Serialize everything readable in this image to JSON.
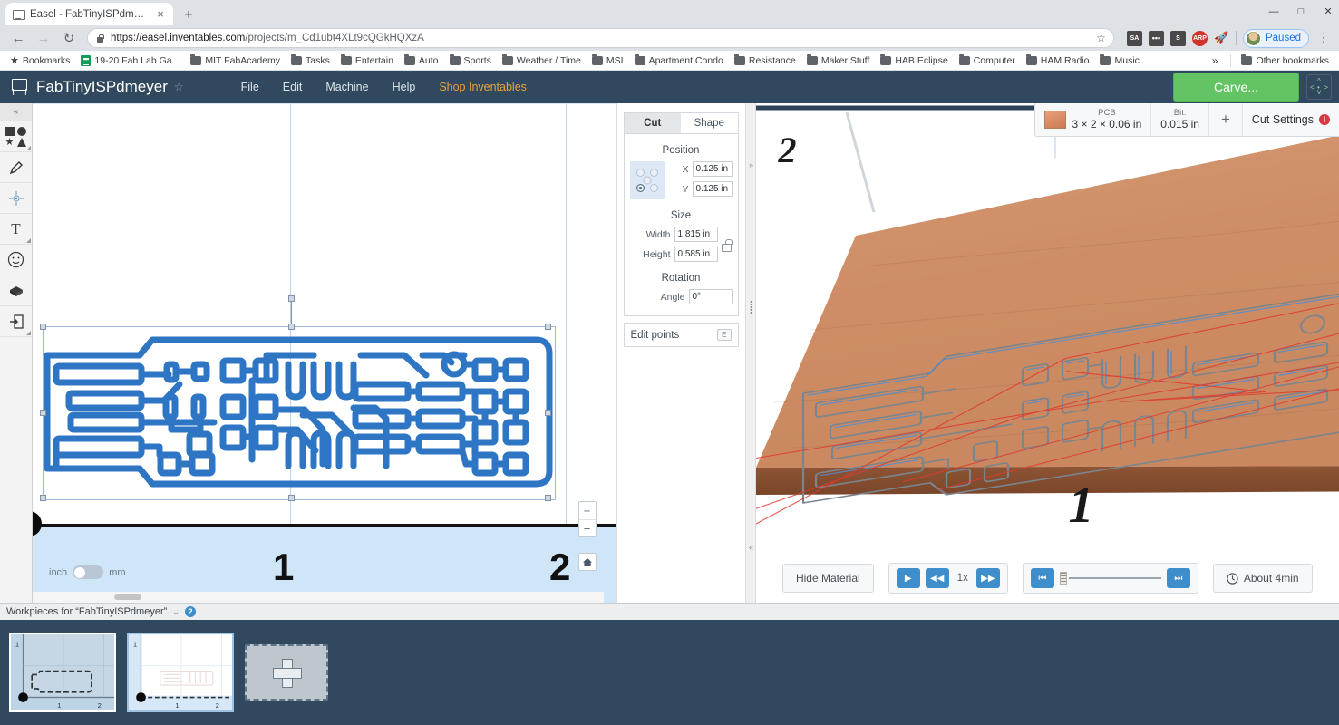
{
  "browser": {
    "tab": {
      "title": "Easel - FabTinyISPdmeyer",
      "favicon": "easel-icon",
      "close": "×"
    },
    "new_tab": "+",
    "window_controls": [
      "—",
      "□",
      "✕"
    ],
    "nav": {
      "back": "←",
      "forward": "→",
      "reload": "↻"
    },
    "url": {
      "scheme_host": "https://easel.inventables.com",
      "path": "/projects/m_Cd1ubt4XLt9cQGkHQXzA",
      "lock": "lock-icon",
      "star": "☆"
    },
    "extensions": [
      {
        "name": "sa-extension",
        "label": "SA",
        "color": "#4a4a4a"
      },
      {
        "name": "dots-extension",
        "label": "•••",
        "color": "#4a4a4a"
      },
      {
        "name": "s-extension",
        "label": "S",
        "color": "#4a4a4a"
      },
      {
        "name": "arp-extension",
        "label": "ARP",
        "color": "#d0342c"
      },
      {
        "name": "rocket-extension",
        "label": "🚀",
        "color": "#e8a33d"
      }
    ],
    "profile": {
      "label": "Paused"
    },
    "kebab": "⋮",
    "bookmarks": [
      {
        "label": "Bookmarks",
        "icon": "star-icon"
      },
      {
        "label": "19-20 Fab Lab Ga...",
        "icon": "sheets-icon"
      },
      {
        "label": "MIT FabAcademy",
        "icon": "folder-icon"
      },
      {
        "label": "Tasks",
        "icon": "folder-icon"
      },
      {
        "label": "Entertain",
        "icon": "folder-icon"
      },
      {
        "label": "Auto",
        "icon": "folder-icon"
      },
      {
        "label": "Sports",
        "icon": "folder-icon"
      },
      {
        "label": "Weather / Time",
        "icon": "folder-icon"
      },
      {
        "label": "MSI",
        "icon": "folder-icon"
      },
      {
        "label": "Apartment Condo",
        "icon": "folder-icon"
      },
      {
        "label": "Resistance",
        "icon": "folder-icon"
      },
      {
        "label": "Maker Stuff",
        "icon": "folder-icon"
      },
      {
        "label": "HAB Eclipse",
        "icon": "folder-icon"
      },
      {
        "label": "Computer",
        "icon": "folder-icon"
      },
      {
        "label": "HAM Radio",
        "icon": "folder-icon"
      },
      {
        "label": "Music",
        "icon": "folder-icon"
      }
    ],
    "bookmarks_overflow": "»",
    "other_bookmarks": "Other bookmarks"
  },
  "app": {
    "logo": "easel-logo",
    "project_title": "FabTinyISPdmeyer",
    "favorite_star": "☆",
    "menu": [
      {
        "label": "File",
        "name": "menu-file"
      },
      {
        "label": "Edit",
        "name": "menu-edit"
      },
      {
        "label": "Machine",
        "name": "menu-machine"
      },
      {
        "label": "Help",
        "name": "menu-help"
      },
      {
        "label": "Shop Inventables",
        "name": "menu-shop-inventables"
      }
    ],
    "carve_button": "Carve...",
    "expand_button": "expand-icon"
  },
  "toolrail": [
    {
      "name": "collapse-rail",
      "icon": "chevron-up-icon",
      "glyph": "«"
    },
    {
      "name": "shapes-tool",
      "icon": "shapes-icon"
    },
    {
      "name": "pen-tool",
      "icon": "pen-icon",
      "glyph": "✒"
    },
    {
      "name": "center-point-tool",
      "icon": "crosshair-icon",
      "glyph": "✵"
    },
    {
      "name": "text-tool",
      "icon": "text-icon",
      "glyph": "T"
    },
    {
      "name": "emoji-tool",
      "icon": "smiley-icon",
      "glyph": "☺"
    },
    {
      "name": "3d-object-tool",
      "icon": "cube-icon",
      "glyph": "⬛"
    },
    {
      "name": "import-tool",
      "icon": "import-icon",
      "glyph": "⇥"
    }
  ],
  "canvas": {
    "ruler_labels": [
      "1",
      "2"
    ],
    "unit_toggle": {
      "left": "inch",
      "right": "mm",
      "selected": "inch"
    },
    "zoom_in": "+",
    "zoom_out": "−",
    "home": "⌂",
    "selection": {
      "name": "pcb-traces-shape"
    }
  },
  "properties": {
    "tabs": [
      {
        "label": "Cut",
        "active": false
      },
      {
        "label": "Shape",
        "active": true
      }
    ],
    "position": {
      "title": "Position",
      "x_label": "X",
      "x_value": "0.125 in",
      "y_label": "Y",
      "y_value": "0.125 in"
    },
    "size": {
      "title": "Size",
      "width_label": "Width",
      "width_value": "1.815 in",
      "height_label": "Height",
      "height_value": "0.585 in",
      "lock_icon": "unlock-icon"
    },
    "rotation": {
      "title": "Rotation",
      "angle_label": "Angle",
      "angle_value": "0°"
    },
    "edit_points": {
      "label": "Edit points",
      "shortcut": "E"
    }
  },
  "divider": {
    "top_handle": "»",
    "bottom_handle": "«",
    "drag_dots": "drag-handle"
  },
  "preview": {
    "material": {
      "swatch": "pcb-material-swatch",
      "top_label": "PCB",
      "bottom_label": "3 × 2 × 0.06 in"
    },
    "bit": {
      "top_label": "Bit:",
      "bottom_label": "0.015 in"
    },
    "add_bit": "+",
    "cut_settings": {
      "label": "Cut Settings",
      "warning": "!"
    },
    "stage_numbers": [
      "2",
      "1"
    ],
    "controls": {
      "hide_material": "Hide Material",
      "play": "▶",
      "rewind": "◀◀",
      "speed": "1x",
      "fast_forward": "▶▶",
      "skip_start": "⏮",
      "skip_end": "⏭",
      "about_time": "About 4min",
      "clock_icon": "clock-icon"
    }
  },
  "workpieces": {
    "header_label": "Workpieces for “FabTinyISPdmeyer”",
    "header_chevron": "⌄",
    "help": "?",
    "items": [
      {
        "name": "workpiece-1",
        "active": false,
        "axis_y": "1",
        "ticks": [
          "1",
          "2"
        ]
      },
      {
        "name": "workpiece-2",
        "active": true,
        "axis_y": "1",
        "ticks": [
          "1",
          "2"
        ]
      }
    ],
    "add_label": "add-workpiece"
  },
  "colors": {
    "header_bg": "#31495e",
    "carve_green": "#62c462",
    "accent_blue": "#3f8ecc",
    "trace_blue": "#2e75c4",
    "material_copper": "#d08f68",
    "shop_orange": "#e8a33d"
  }
}
